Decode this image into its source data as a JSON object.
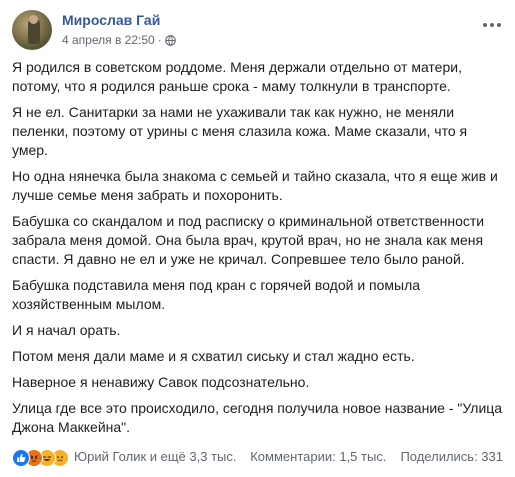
{
  "post": {
    "author": "Мирослав Гай",
    "timestamp": "4 апреля в 22:50",
    "separator": "·",
    "privacy_icon": "globe-icon",
    "more_icon": "more-options-icon",
    "paragraphs": [
      "Я родился в советском роддоме. Меня держали отдельно от матери, потому, что я родился раньше срока - маму толкнули в транспорте.",
      "Я не ел. Санитарки за нами не ухаживали так как нужно, не меняли пеленки, поэтому от урины с меня слазила кожа. Маме сказали, что я умер.",
      "Но одна нянечка была знакома с семьей и тайно сказала, что я еще жив и лучше семье меня забрать и похоронить.",
      "Бабушка со скандалом и под расписку о криминальной ответственности забрала меня домой. Она была врач, крутой врач, но не знала как меня спасти. Я давно не ел и уже не кричал. Сопревшее тело было раной.",
      "Бабушка подставила меня под кран с горячей водой и помыла хозяйственным мылом.",
      "И я начал орать.",
      "Потом меня дали маме и я схватил сиську и стал жадно есть.",
      "Наверное я ненавижу Савок подсознательно.",
      "Улица где все это происходило, сегодня получила новое название - \"Улица Джона Маккейна\"."
    ]
  },
  "footer": {
    "reaction_icons": [
      "like-icon",
      "angry-icon",
      "haha-icon",
      "sad-icon"
    ],
    "reactors": "Юрий Голик и ещё 3,3 тыс.",
    "comments": "Комментарии: 1,5 тыс.",
    "shares": "Поделились: 331"
  },
  "colors": {
    "author_link": "#385898",
    "meta_text": "#616770",
    "body_text": "#1c1e21",
    "like_blue": "#1877f2"
  }
}
